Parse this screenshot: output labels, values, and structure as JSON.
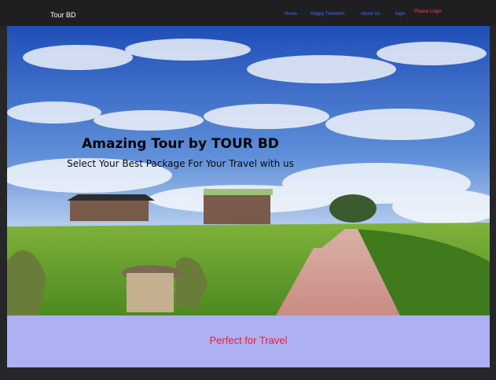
{
  "header": {
    "brand": "Tour BD",
    "nav": [
      "Home",
      "Happy Travelers",
      "About Us",
      "login"
    ],
    "login_status": "Please Login"
  },
  "hero": {
    "title": "Amazing Tour by TOUR BD",
    "subtitle": "Select Your Best Package For Your Travel with us"
  },
  "band": {
    "text": "Perfect for Travel"
  },
  "colors": {
    "nav_link": "#3f6bff",
    "login_status": "#ff3b4a",
    "band_bg": "#adb0f3",
    "band_text": "#e8203c"
  }
}
